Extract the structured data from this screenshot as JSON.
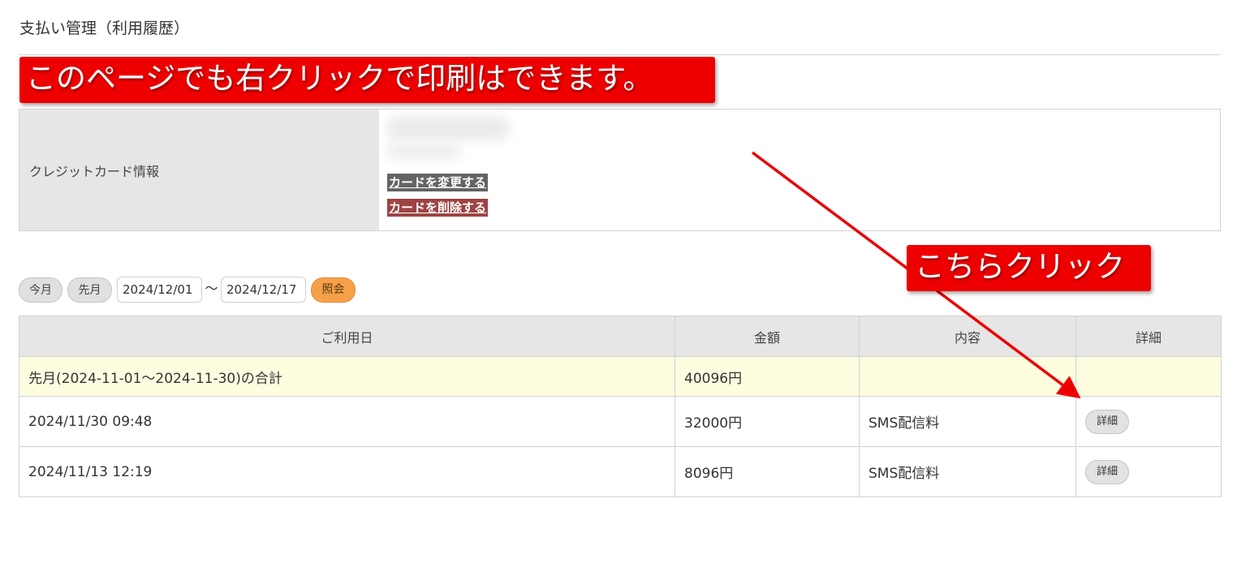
{
  "page": {
    "title": "支払い管理（利用履歴）"
  },
  "annotations": {
    "banner_text": "このページでも右クリックで印刷はできます。",
    "callout_text": "こちらクリック",
    "color": "#ee0000"
  },
  "card": {
    "label": "クレジットカード情報",
    "change_button": "カードを変更する",
    "delete_button": "カードを削除する"
  },
  "filter": {
    "this_month": "今月",
    "last_month": "先月",
    "date_from": "2024/12/01",
    "separator": "〜",
    "date_to": "2024/12/17",
    "search_button": "照会"
  },
  "history": {
    "headers": [
      "ご利用日",
      "金額",
      "内容",
      "詳細"
    ],
    "total_row": {
      "label": "先月(2024-11-01〜2024-11-30)の合計",
      "amount": "40096円"
    },
    "rows": [
      {
        "date": "2024/11/30 09:48",
        "amount": "32000円",
        "content": "SMS配信料",
        "detail": "詳細"
      },
      {
        "date": "2024/11/13 12:19",
        "amount": "8096円",
        "content": "SMS配信料",
        "detail": "詳細"
      }
    ]
  },
  "colors": {
    "accent_orange": "#f6a14a",
    "header_gray": "#e6e6e6",
    "total_row_bg": "#fffde0",
    "change_button_bg": "#646464",
    "delete_button_bg": "#9e4343"
  }
}
